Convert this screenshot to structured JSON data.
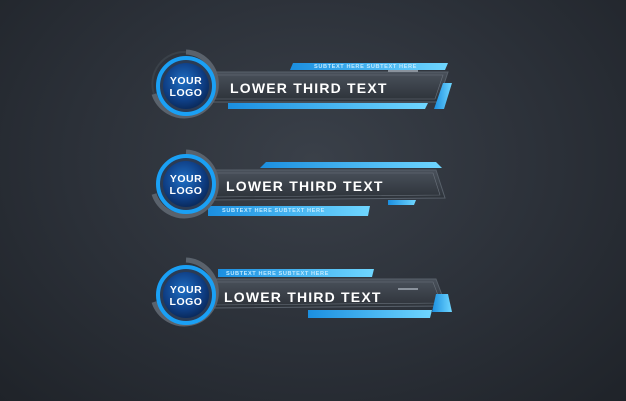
{
  "lower_thirds": [
    {
      "logo_line1": "YOUR",
      "logo_line2": "LOGO",
      "main_text": "LOWER THIRD TEXT",
      "sub_text": "SUBTEXT HERE SUBTEXT HERE"
    },
    {
      "logo_line1": "YOUR",
      "logo_line2": "LOGO",
      "main_text": "LOWER THIRD TEXT",
      "sub_text": "SUBTEXT HERE SUBTEXT HERE"
    },
    {
      "logo_line1": "YOUR",
      "logo_line2": "LOGO",
      "main_text": "LOWER THIRD TEXT",
      "sub_text": "SUBTEXT HERE SUBTEXT HERE"
    }
  ],
  "colors": {
    "accent": "#2aa7f2",
    "accent_light": "#6fd0ff",
    "bar": "#3a4048",
    "background": "#2b3038"
  }
}
